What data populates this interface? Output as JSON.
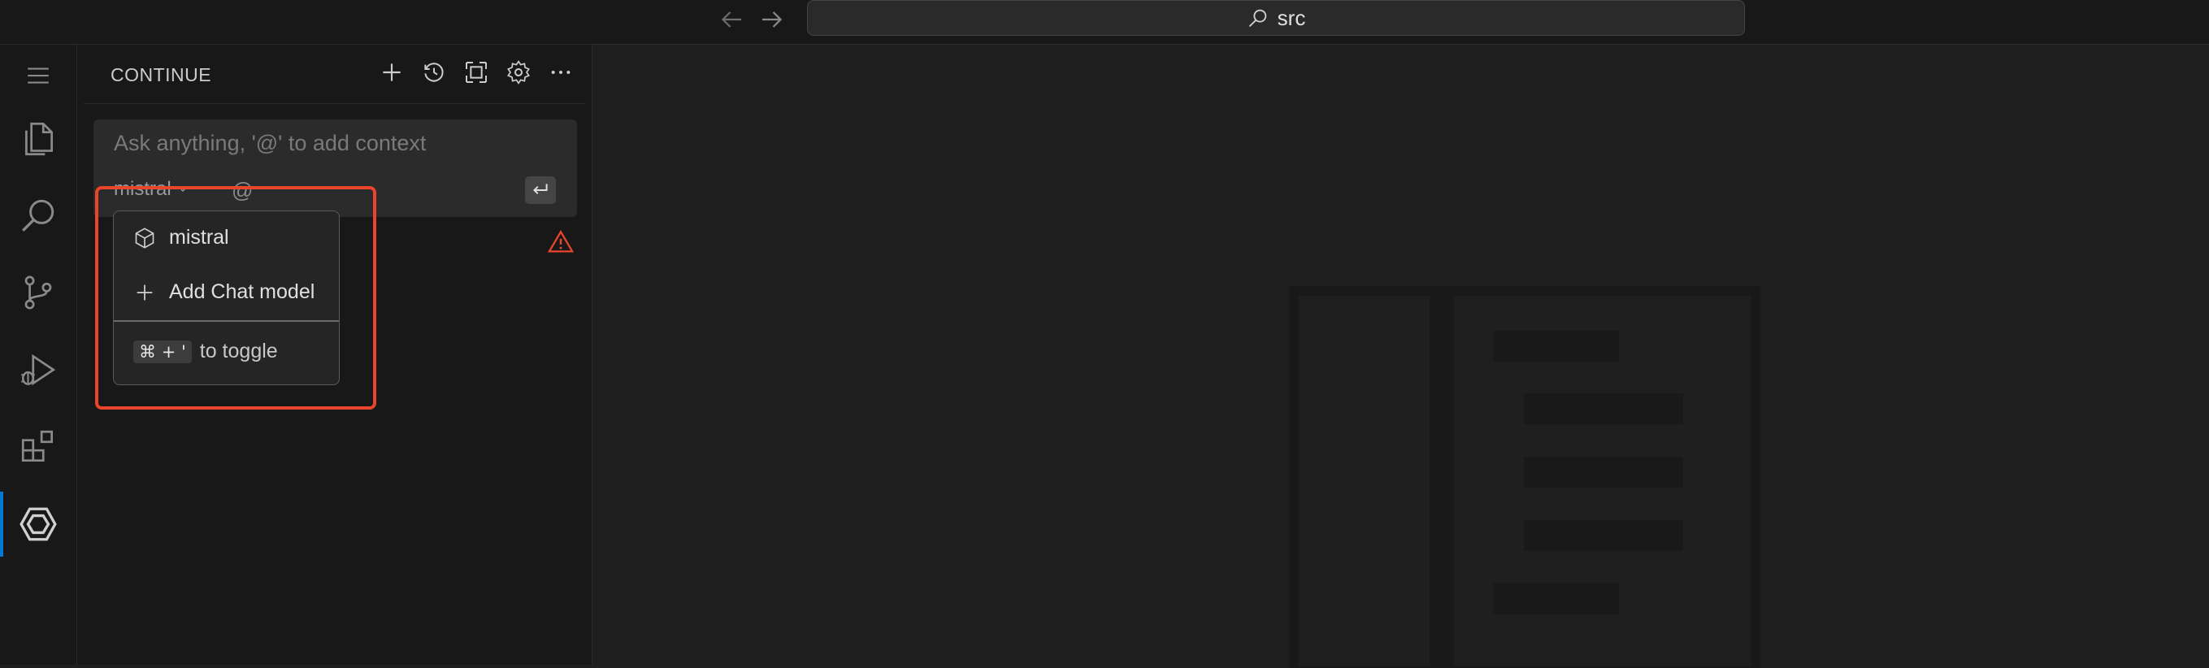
{
  "titlebar": {
    "search_text": "src",
    "back_icon": "arrow-left-icon",
    "forward_icon": "arrow-right-icon"
  },
  "activity_bar": {
    "items": [
      {
        "icon": "menu-icon"
      },
      {
        "icon": "explorer-files-icon"
      },
      {
        "icon": "search-icon"
      },
      {
        "icon": "source-control-icon"
      },
      {
        "icon": "run-debug-icon"
      },
      {
        "icon": "extensions-icon"
      },
      {
        "icon": "continue-icon",
        "active": true
      }
    ],
    "accent_color": "#0078d4"
  },
  "sidebar": {
    "title": "CONTINUE",
    "toolbar_icons": [
      "plus-icon",
      "history-icon",
      "fullscreen-icon",
      "gear-icon",
      "more-icon"
    ],
    "input": {
      "placeholder": "Ask anything, '@' to add context",
      "model": "mistral",
      "at_symbol": "@"
    },
    "warning_color": "#e8452c"
  },
  "dropdown": {
    "items": [
      {
        "label": "mistral",
        "icon": "cube-icon"
      },
      {
        "label": "Add Chat model",
        "icon": "plus-icon"
      }
    ],
    "shortcut": {
      "key1": "⌘",
      "key2": "+",
      "key3": "'",
      "label": "to toggle"
    }
  },
  "highlight_color": "#e8452c"
}
